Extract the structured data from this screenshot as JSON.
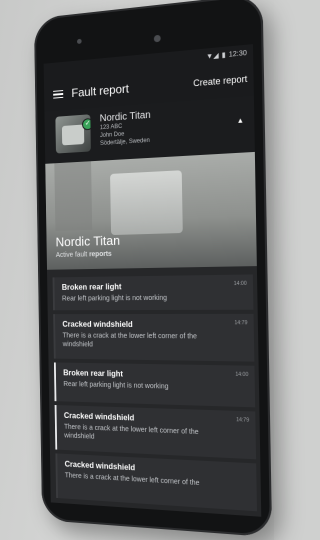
{
  "status_bar": {
    "time": "12:30"
  },
  "app_bar": {
    "title": "Fault report",
    "create_label": "Create report"
  },
  "vehicle": {
    "name": "Nordic Titan",
    "plate": "123 ABC",
    "driver": "John Doe",
    "location": "Södertälje, Sweden"
  },
  "hero": {
    "title": "Nordic Titan",
    "subtitle_prefix": "Active fault ",
    "subtitle_strong": "reports"
  },
  "reports": [
    {
      "title": "Broken rear light",
      "description": "Rear left parking light is not working",
      "time": "14:00"
    },
    {
      "title": "Cracked windshield",
      "description": "There is a crack at the lower left corner of the windshield",
      "time": "14:79"
    },
    {
      "title": "Broken rear light",
      "description": "Rear left parking light is not working",
      "time": "14:00"
    },
    {
      "title": "Cracked windshield",
      "description": "There is a crack at the lower left corner of the windshield",
      "time": "14:79"
    },
    {
      "title": "Cracked windshield",
      "description": "There is a crack at the lower left corner of the",
      "time": ""
    }
  ]
}
